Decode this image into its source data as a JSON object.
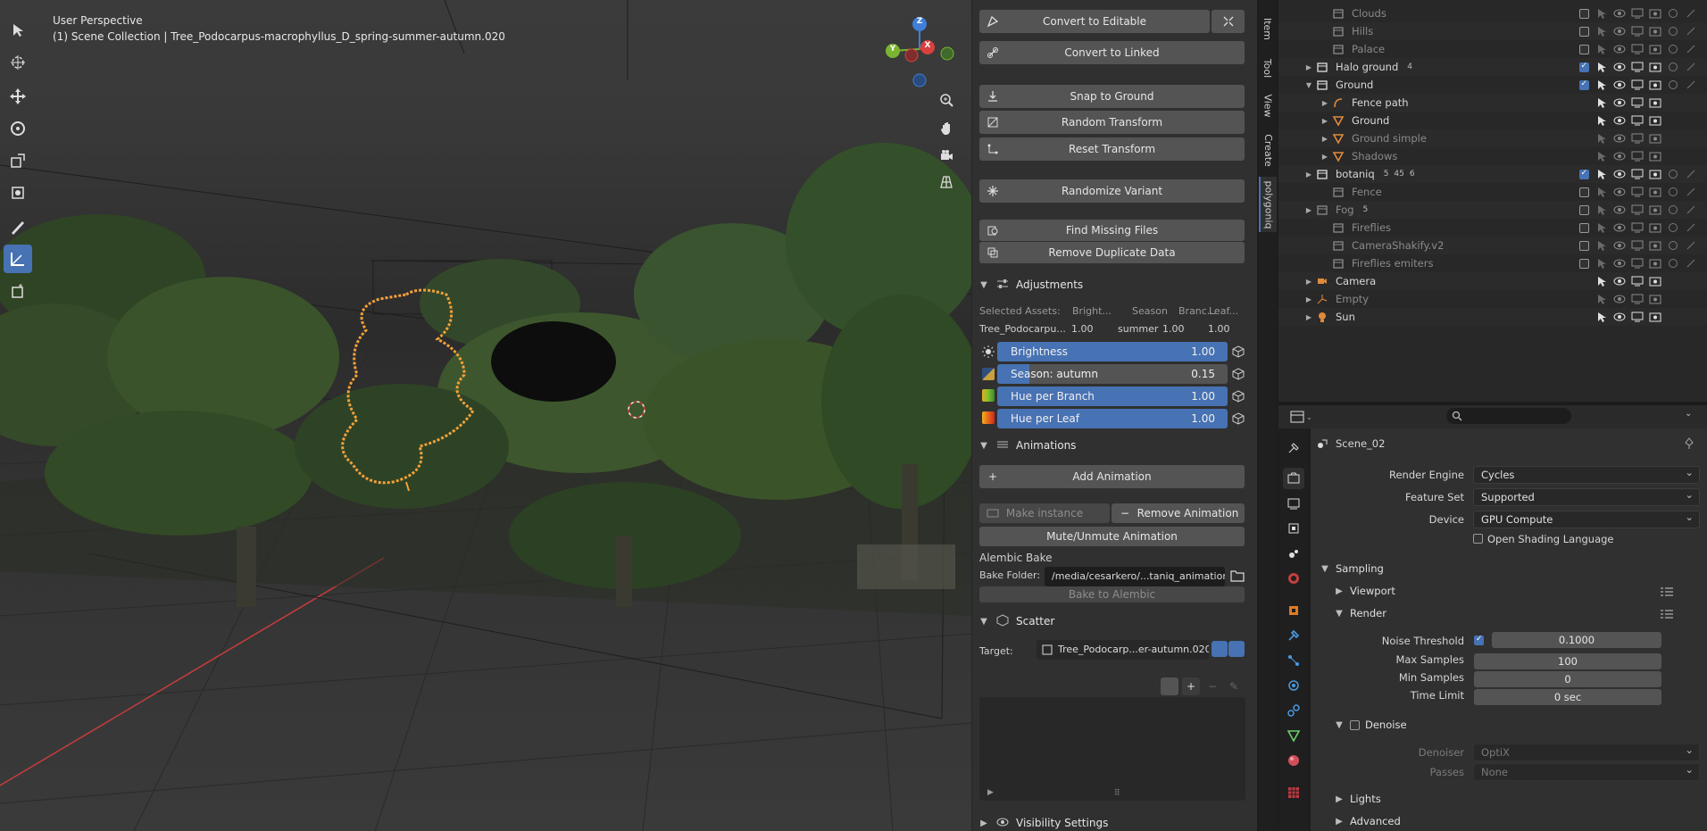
{
  "viewport": {
    "title_line1": "User Perspective",
    "title_line2": "(1) Scene Collection | Tree_Podocarpus-macrophyllus_D_spring-summer-autumn.020",
    "gizmo": {
      "z": "Z",
      "y": "Y",
      "x": "X"
    },
    "colors": {
      "grid_red": "#c83c3c",
      "selection": "#f2a13a",
      "tree_green": "#3d5a2a"
    }
  },
  "npanel": {
    "buttons": {
      "convert_editable": "Convert to Editable",
      "convert_linked": "Convert to Linked",
      "snap_ground": "Snap to Ground",
      "random_transform": "Random Transform",
      "reset_transform": "Reset Transform",
      "randomize_variant": "Randomize Variant",
      "find_missing": "Find Missing Files",
      "remove_duplicate": "Remove Duplicate Data",
      "add_animation": "Add Animation",
      "make_instance": "Make instance",
      "remove_animation": "Remove Animation",
      "mute_unmute": "Mute/Unmute Animation",
      "bake_alembic": "Bake to Alembic"
    },
    "adjustments": {
      "title": "Adjustments",
      "header_cols": [
        "Selected Assets:",
        "Bright...",
        "Season",
        "Branc...",
        "Leaf..."
      ],
      "row": [
        "Tree_Podocarpu...",
        "1.00",
        "summer",
        "1.00",
        "1.00"
      ],
      "sliders": [
        {
          "label": "Brightness",
          "value": "1.00",
          "color": "#d0d0d0"
        },
        {
          "label": "Season: autumn",
          "value": "0.15",
          "color": "#2f4f7f"
        },
        {
          "label": "Hue per Branch",
          "value": "1.00",
          "color": "#7fbf2f"
        },
        {
          "label": "Hue per Leaf",
          "value": "1.00",
          "color": "#e8651a"
        }
      ]
    },
    "animations": {
      "title": "Animations"
    },
    "alembic": {
      "title": "Alembic Bake",
      "folder_label": "Bake Folder:",
      "folder_value": "/media/cesarkero/...taniq_animations/"
    },
    "scatter": {
      "title": "Scatter",
      "target_label": "Target:",
      "target_value": "Tree_Podocarp...er-autumn.020"
    },
    "visibility": {
      "title": "Visibility Settings"
    },
    "tabs": [
      "Item",
      "Tool",
      "View",
      "Create",
      "polygoniq"
    ]
  },
  "outliner": {
    "rows": [
      {
        "label": "Clouds",
        "dim": true
      },
      {
        "label": "Hills",
        "dim": true
      },
      {
        "label": "Palace",
        "dim": true
      },
      {
        "label": "Halo ground",
        "dim": false,
        "badge": "4"
      },
      {
        "label": "Ground",
        "dim": false
      },
      {
        "label": "Fence path",
        "dim": false
      },
      {
        "label": "Ground",
        "dim": false
      },
      {
        "label": "Ground simple",
        "dim": true
      },
      {
        "label": "Shadows",
        "dim": true
      },
      {
        "label": "botaniq",
        "dim": false,
        "badge": "5",
        "badge2": "45",
        "badge3": "6"
      },
      {
        "label": "Fence",
        "dim": true
      },
      {
        "label": "Fog",
        "dim": true,
        "badge": "5"
      },
      {
        "label": "Fireflies",
        "dim": true
      },
      {
        "label": "CameraShakify.v2",
        "dim": true
      },
      {
        "label": "Fireflies emiters",
        "dim": true
      },
      {
        "label": "Camera",
        "dim": false
      },
      {
        "label": "Empty",
        "dim": true
      },
      {
        "label": "Sun",
        "dim": false
      }
    ]
  },
  "properties": {
    "scene_name": "Scene_02",
    "render_engine_label": "Render Engine",
    "render_engine": "Cycles",
    "feature_set_label": "Feature Set",
    "feature_set": "Supported",
    "device_label": "Device",
    "device": "GPU Compute",
    "osl_label": "Open Shading Language",
    "sampling": "Sampling",
    "viewport": "Viewport",
    "render": "Render",
    "noise_threshold_label": "Noise Threshold",
    "noise_threshold": "0.1000",
    "max_samples_label": "Max Samples",
    "max_samples": "100",
    "min_samples_label": "Min Samples",
    "min_samples": "0",
    "time_limit_label": "Time Limit",
    "time_limit": "0 sec",
    "denoise": "Denoise",
    "denoiser_label": "Denoiser",
    "denoiser": "OptiX",
    "passes_label": "Passes",
    "passes": "None",
    "lights": "Lights",
    "advanced": "Advanced"
  }
}
